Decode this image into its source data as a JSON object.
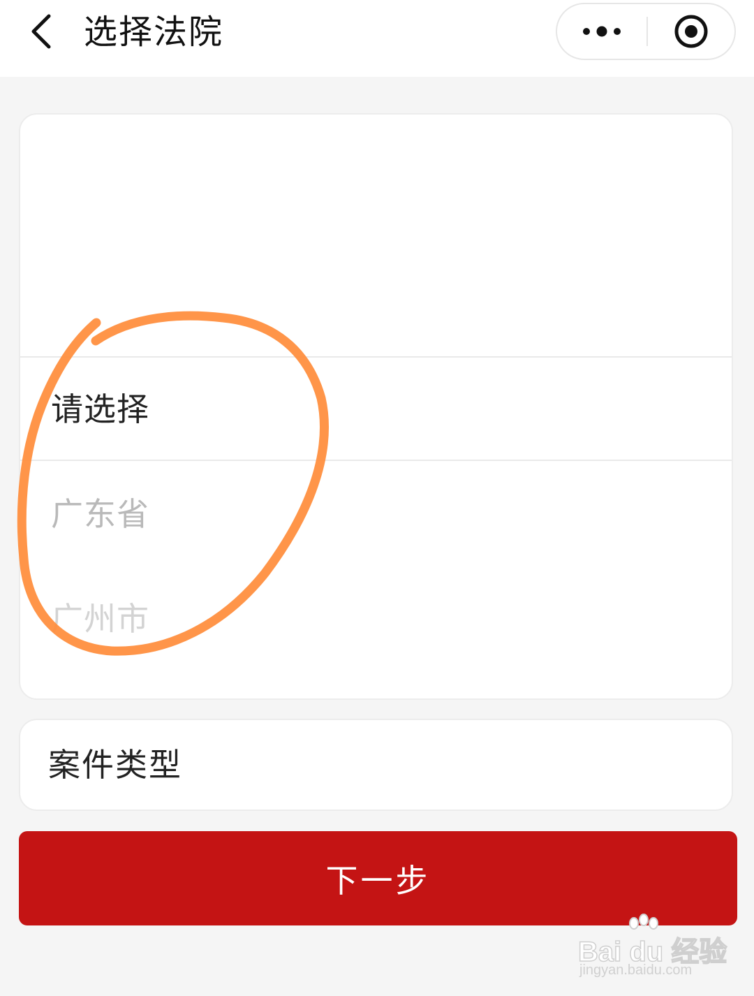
{
  "header": {
    "title": "选择法院",
    "back_icon": "chevron-left-icon",
    "more_icon": "more-dots-icon",
    "close_icon": "target-close-icon"
  },
  "picker": {
    "selected_label": "请选择",
    "options": [
      "广东省",
      "广州市"
    ]
  },
  "case_type": {
    "label": "案件类型"
  },
  "next_button": {
    "label": "下一步",
    "color": "#c41414"
  },
  "annotation": {
    "color": "#ff8c3a"
  },
  "watermark": {
    "logo": "Bai du 经验",
    "url": "jingyan.baidu.com"
  }
}
